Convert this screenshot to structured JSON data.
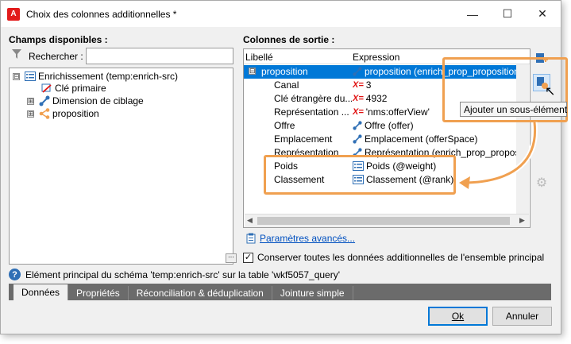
{
  "window": {
    "title": "Choix des colonnes additionnelles *"
  },
  "left": {
    "heading": "Champs disponibles :",
    "search_label": "Rechercher :",
    "search_value": "",
    "tree": [
      {
        "label": "Enrichissement (temp:enrich-src)",
        "icon": "list-icon",
        "expander": "⊟"
      },
      {
        "label": "Clé primaire",
        "icon": "key-icon",
        "expander": ""
      },
      {
        "label": "Dimension de ciblage",
        "icon": "link-icon",
        "expander": "⊞"
      },
      {
        "label": "proposition",
        "icon": "share-icon",
        "expander": "⊞"
      }
    ]
  },
  "right": {
    "heading": "Colonnes de sortie :",
    "col_label": "Libellé",
    "col_expr": "Expression",
    "rows": [
      {
        "label": "proposition",
        "expr": "proposition (enrich_prop_proposition)",
        "icon": "link-icon",
        "selected": true
      },
      {
        "label": "Canal",
        "expr": "3",
        "icon": "expression-icon",
        "selected": false
      },
      {
        "label": "Clé étrangère du...",
        "expr": "4932",
        "icon": "expression-icon",
        "selected": false
      },
      {
        "label": "Représentation ...",
        "expr": "'nms:offerView'",
        "icon": "expression-icon",
        "selected": false
      },
      {
        "label": "Offre",
        "expr": "Offre (offer)",
        "icon": "link-icon",
        "selected": false
      },
      {
        "label": "Emplacement",
        "expr": "Emplacement (offerSpace)",
        "icon": "link-icon",
        "selected": false
      },
      {
        "label": "Représentation",
        "expr": "Représentation (enrich_prop_proposit...",
        "icon": "link-icon",
        "selected": false
      },
      {
        "label": "Poids",
        "expr": "Poids (@weight)",
        "icon": "list-icon",
        "selected": false
      },
      {
        "label": "Classement",
        "expr": "Classement (@rank)",
        "icon": "list-icon",
        "selected": false
      }
    ],
    "xeq": "X=",
    "advanced_link": "Paramètres avancés...",
    "keep_label": "Conserver toutes les données additionnelles de l'ensemble principal",
    "keep_checked": "✓",
    "tooltip": "Ajouter un sous-élément"
  },
  "status": "Elément principal du schéma 'temp:enrich-src' sur la table 'wkf5057_query'",
  "tabs": [
    "Données",
    "Propriétés",
    "Réconciliation & déduplication",
    "Jointure simple"
  ],
  "buttons": {
    "ok": "Ok",
    "cancel": "Annuler"
  },
  "colors": {
    "accent": "#0078d7",
    "annotation": "#f0a050",
    "expression": "#e01010",
    "icon_blue": "#2f6fb5"
  }
}
